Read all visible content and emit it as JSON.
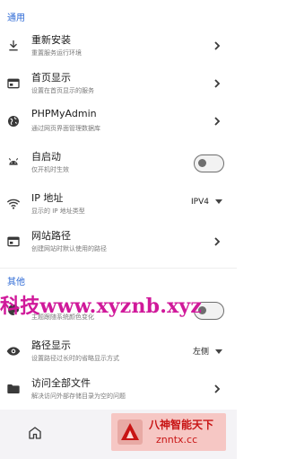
{
  "sections": {
    "general_label": "通用",
    "other_label": "其他"
  },
  "general_items": [
    {
      "title": "重新安装",
      "subtitle": "重置服务运行环境",
      "icon": "download-icon",
      "control": "chevron"
    },
    {
      "title": "首页显示",
      "subtitle": "设置在首页显示的服务",
      "icon": "window-icon",
      "control": "chevron"
    },
    {
      "title": "PHPMyAdmin",
      "subtitle": "通过网页界面管理数据库",
      "icon": "globe-icon",
      "control": "chevron"
    },
    {
      "title": "自启动",
      "subtitle": "仅开机时生效",
      "icon": "android-icon",
      "control": "toggle",
      "enabled": false
    },
    {
      "title": "IP 地址",
      "subtitle": "显示的 IP 地址类型",
      "icon": "wifi-icon",
      "control": "dropdown",
      "value": "IPV4"
    },
    {
      "title": "网站路径",
      "subtitle": "创建网站时默认使用的路径",
      "icon": "window-icon",
      "control": "chevron"
    }
  ],
  "other_items": [
    {
      "title": "",
      "subtitle": "主题跟随系统颜色变化",
      "icon": "palette-icon",
      "control": "toggle",
      "enabled": false
    },
    {
      "title": "路径显示",
      "subtitle": "设置路径过长时的省略显示方式",
      "icon": "eye-icon",
      "control": "dropdown",
      "value": "左侧"
    },
    {
      "title": "访问全部文件",
      "subtitle": "解决访问外部存储目录为空的问题",
      "icon": "folder-icon",
      "control": "chevron"
    }
  ],
  "watermark": {
    "text": "科技www.xyznb.xyz"
  },
  "bottom_nav": {
    "home_icon": "home-icon"
  },
  "overlay_logo": {
    "text": "八神智能天下",
    "url": "znntx.cc"
  },
  "colors": {
    "accent": "#2f6bd6",
    "watermark": "#d0199a",
    "logo_red": "#c81414"
  }
}
